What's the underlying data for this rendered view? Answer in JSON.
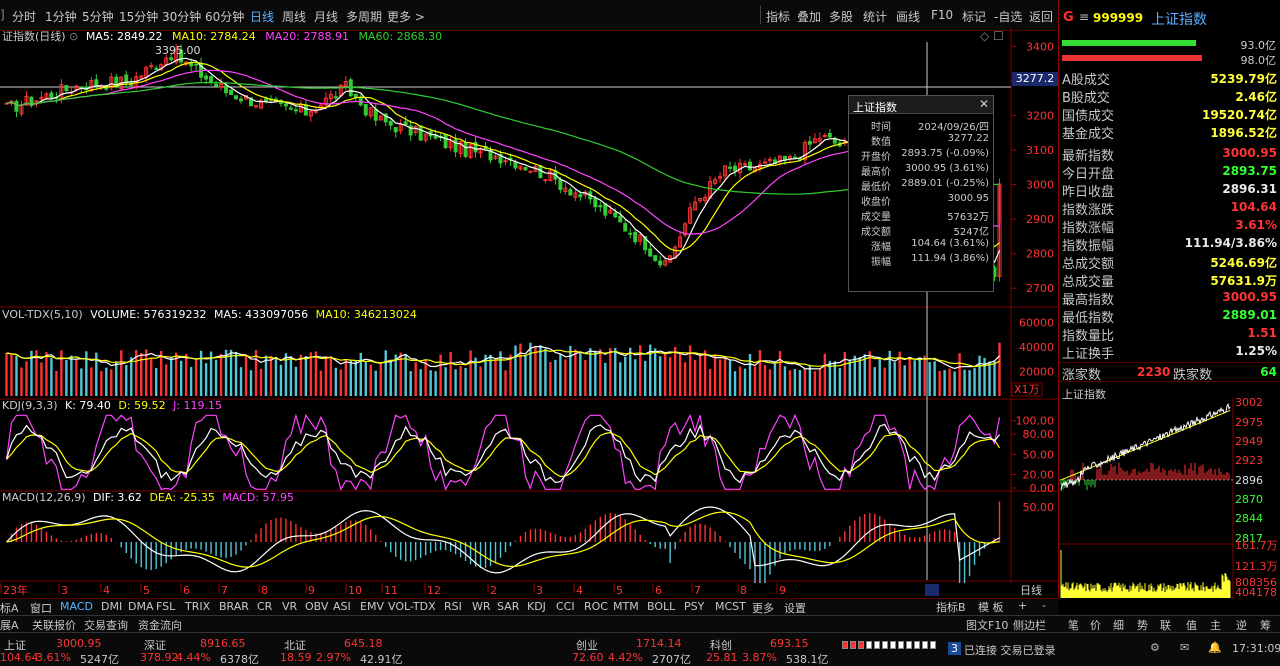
{
  "toolbar": {
    "periods": [
      "分时",
      "1分钟",
      "5分钟",
      "15分钟",
      "30分钟",
      "60分钟",
      "日线",
      "周线",
      "月线",
      "多周期",
      "更多 >"
    ],
    "active_period": "日线",
    "tools": [
      "指标",
      "叠加",
      "多股",
      "统计",
      "画线",
      "F10",
      "标记",
      "-自选",
      "返回"
    ]
  },
  "header": {
    "flag": "G",
    "menu": "≡",
    "code": "999999",
    "name": "上证指数"
  },
  "ma_legend": {
    "title": "证指数(日线)",
    "ma5": "MA5: 2849.22",
    "ma10": "MA10: 2784.24",
    "ma20": "MA20: 2788.91",
    "ma60": "MA60: 2868.30"
  },
  "price_annotation": "3395.00",
  "crosshair_price": "3277.2",
  "price_axis": [
    "3400",
    "3300",
    "3200",
    "3100",
    "3000",
    "2900",
    "2800",
    "2700"
  ],
  "volume_legend": {
    "title": "VOL-TDX(5,10)",
    "volume": "VOLUME: 576319232",
    "ma5": "MA5: 433097056",
    "ma10": "MA10: 346213024"
  },
  "volume_axis": [
    "60000",
    "40000",
    "20000"
  ],
  "volume_unit": "X1万",
  "kdj_legend": {
    "title": "KDJ(9,3,3)",
    "k": "K: 79.40",
    "d": "D: 59.52",
    "j": "J: 119.15"
  },
  "kdj_axis": [
    "100.00",
    "80.00",
    "50.00",
    "20.00",
    "0.00"
  ],
  "macd_legend": {
    "title": "MACD(12,26,9)",
    "dif": "DIF: 3.62",
    "dea": "DEA: -25.35",
    "macd": "MACD: 57.95"
  },
  "macd_axis": [
    "50.00"
  ],
  "date_axis": [
    "23年",
    "3",
    "4",
    "5",
    "6",
    "7",
    "8",
    "9",
    "10",
    "11",
    "12",
    "2",
    "3",
    "4",
    "5",
    "6",
    "7",
    "8",
    "9"
  ],
  "date_axis_label": "日线",
  "popup": {
    "title": "上证指数",
    "rows": [
      {
        "k": "时间",
        "v": "2024/09/26/四",
        "c": "wht"
      },
      {
        "k": "数值",
        "v": "3277.22",
        "c": "wht"
      },
      {
        "k": "开盘价",
        "v": "2893.75 (-0.09%)",
        "c": "grn"
      },
      {
        "k": "最高价",
        "v": "3000.95 (3.61%)",
        "c": "red"
      },
      {
        "k": "最低价",
        "v": "2889.01 (-0.25%)",
        "c": "grn"
      },
      {
        "k": "收盘价",
        "v": "3000.95",
        "c": "red"
      },
      {
        "k": "成交量",
        "v": "57632万",
        "c": "yel"
      },
      {
        "k": "成交额",
        "v": "5247亿",
        "c": "wht"
      },
      {
        "k": "涨幅",
        "v": "104.64 (3.61%)",
        "c": "red"
      },
      {
        "k": "振幅",
        "v": "111.94 (3.86%)",
        "c": "wht"
      }
    ]
  },
  "right_panel": {
    "bar_values": [
      "93.0亿",
      "98.0亿"
    ],
    "turnover": [
      {
        "k": "A股成交",
        "v": "5239.79亿"
      },
      {
        "k": "B股成交",
        "v": "2.46亿"
      },
      {
        "k": "国债成交",
        "v": "19520.74亿"
      },
      {
        "k": "基金成交",
        "v": "1896.52亿"
      }
    ],
    "stats": [
      {
        "k": "最新指数",
        "v": "3000.95",
        "c": "red"
      },
      {
        "k": "今日开盘",
        "v": "2893.75",
        "c": "grn"
      },
      {
        "k": "昨日收盘",
        "v": "2896.31",
        "c": "wht"
      },
      {
        "k": "指数涨跌",
        "v": "104.64",
        "c": "red"
      },
      {
        "k": "指数涨幅",
        "v": "3.61%",
        "c": "red"
      },
      {
        "k": "指数振幅",
        "v": "111.94/3.86%",
        "c": "wht"
      },
      {
        "k": "总成交额",
        "v": "5246.69亿",
        "c": "yel"
      },
      {
        "k": "总成交量",
        "v": "57631.9万",
        "c": "yel"
      },
      {
        "k": "最高指数",
        "v": "3000.95",
        "c": "red"
      },
      {
        "k": "最低指数",
        "v": "2889.01",
        "c": "grn"
      },
      {
        "k": "指数量比",
        "v": "1.51",
        "c": "red"
      },
      {
        "k": "上证换手",
        "v": "1.25%",
        "c": "wht"
      }
    ],
    "up_label": "涨家数",
    "up_count": "2230",
    "down_label": "跌家数",
    "down_count": "64",
    "mini_title": "上证指数",
    "mini_axis": [
      "3002",
      "2975",
      "2949",
      "2923",
      "2896",
      "2870",
      "2844",
      "2817"
    ],
    "mini_vol_axis": [
      "161.7万",
      "121.3万",
      "808356",
      "404178"
    ]
  },
  "indicator_tabs": [
    "标A",
    "窗口",
    "MACD",
    "DMI",
    "DMA",
    "FSL",
    "TRIX",
    "BRAR",
    "CR",
    "VR",
    "OBV",
    "ASI",
    "EMV",
    "VOL-TDX",
    "RSI",
    "WR",
    "SAR",
    "KDJ",
    "CCI",
    "ROC",
    "MTM",
    "BOLL",
    "PSY",
    "MCST",
    "更多",
    "设置"
  ],
  "indicator_tab_active": "MACD",
  "indicator_tabs_right": [
    "指标B",
    "模 板",
    "+",
    "-"
  ],
  "sub_tabs": [
    "展A",
    "关联报价",
    "交易查询",
    "资金流向"
  ],
  "right_toolbar": [
    "图文F10",
    "侧边栏",
    "笔",
    "价",
    "细",
    "势",
    "联",
    "值",
    "主",
    "逆",
    "筹"
  ],
  "status": {
    "markets": [
      {
        "name": "上证",
        "value": "3000.95",
        "chg": "104.64",
        "pct": "3.61%",
        "amt": "5247亿"
      },
      {
        "name": "深证",
        "value": "8916.65",
        "chg": "378.92",
        "pct": "4.44%",
        "amt": "6378亿"
      },
      {
        "name": "北证",
        "value": "645.18",
        "chg": "18.59",
        "pct": "2.97%",
        "amt": "42.91亿"
      },
      {
        "name": "创业",
        "value": "1714.14",
        "chg": "72.60",
        "pct": "4.42%",
        "amt": "2707亿"
      },
      {
        "name": "科创",
        "value": "693.15",
        "chg": "25.81",
        "pct": "3.87%",
        "amt": "538.1亿"
      }
    ],
    "connection": "已连接 交易已登录",
    "conn_num": "3",
    "time": "17:31:09"
  },
  "colors": {
    "up": "#ff3333",
    "down": "#33ff33",
    "ma5": "#ffffff",
    "ma10": "#ffff00",
    "ma20": "#ff44ff",
    "ma60": "#33cc33",
    "vol_up": "#ff3333",
    "vol_down": "#52c7d8"
  }
}
